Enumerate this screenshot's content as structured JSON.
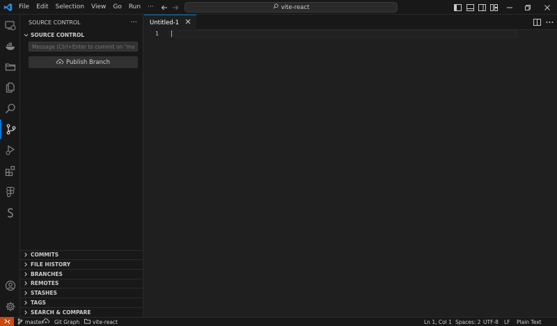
{
  "window": {
    "menu": [
      "File",
      "Edit",
      "Selection",
      "View",
      "Go",
      "Run",
      "···"
    ],
    "search_text": "vite-react"
  },
  "sidebar": {
    "title": "SOURCE CONTROL",
    "more_label": "···",
    "section_title": "SOURCE CONTROL",
    "commit_placeholder": "Message (Ctrl+Enter to commit on \"master\")",
    "publish_label": "Publish Branch",
    "panels": [
      "COMMITS",
      "FILE HISTORY",
      "BRANCHES",
      "REMOTES",
      "STASHES",
      "TAGS",
      "SEARCH & COMPARE"
    ]
  },
  "editor": {
    "tab_label": "Untitled-1",
    "line_number": "1"
  },
  "statusbar": {
    "branch": "master",
    "git_graph": "Git Graph",
    "folder": "vite-react",
    "position": "Ln 1, Col 1",
    "spaces": "Spaces: 2",
    "encoding": "UTF-8",
    "eol": "LF",
    "language": "Plain Text"
  },
  "colors": {
    "accent": "#0078d4",
    "remote": "#c84a0e",
    "background": "#1f1f1f",
    "chrome": "#181818"
  }
}
